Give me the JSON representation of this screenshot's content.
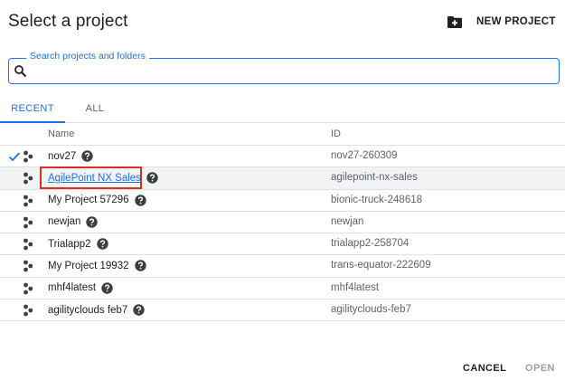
{
  "dialog": {
    "title": "Select a project",
    "new_project_label": "NEW PROJECT"
  },
  "search": {
    "label": "Search projects and folders",
    "value": ""
  },
  "tabs": [
    {
      "label": "RECENT",
      "active": true
    },
    {
      "label": "ALL",
      "active": false
    }
  ],
  "table": {
    "columns": {
      "name": "Name",
      "id": "ID"
    },
    "rows": [
      {
        "name": "nov27",
        "id": "nov27-260309",
        "selected": true
      },
      {
        "name": "AgilePoint NX Sales",
        "id": "agilepoint-nx-sales",
        "selected": false,
        "highlighted": true
      },
      {
        "name": "My Project 57296",
        "id": "bionic-truck-248618",
        "selected": false
      },
      {
        "name": "newjan",
        "id": "newjan",
        "selected": false
      },
      {
        "name": "Trialapp2",
        "id": "trialapp2-258704",
        "selected": false
      },
      {
        "name": "My Project 19932",
        "id": "trans-equator-222609",
        "selected": false
      },
      {
        "name": "mhf4latest",
        "id": "mhf4latest",
        "selected": false
      },
      {
        "name": "agilityclouds feb7",
        "id": "agilityclouds-feb7",
        "selected": false
      }
    ]
  },
  "footer": {
    "cancel_label": "CANCEL",
    "open_label": "OPEN"
  },
  "colors": {
    "accent": "#1a73e8",
    "highlight_box": "#d93025",
    "text": "#202124",
    "muted": "#5f6368",
    "disabled": "#9aa0a6"
  },
  "icons": {
    "new_project": "folder-add-icon",
    "search": "search-icon",
    "selected": "check-icon",
    "project": "project-hierarchy-icon",
    "help": "help-circle-icon"
  }
}
